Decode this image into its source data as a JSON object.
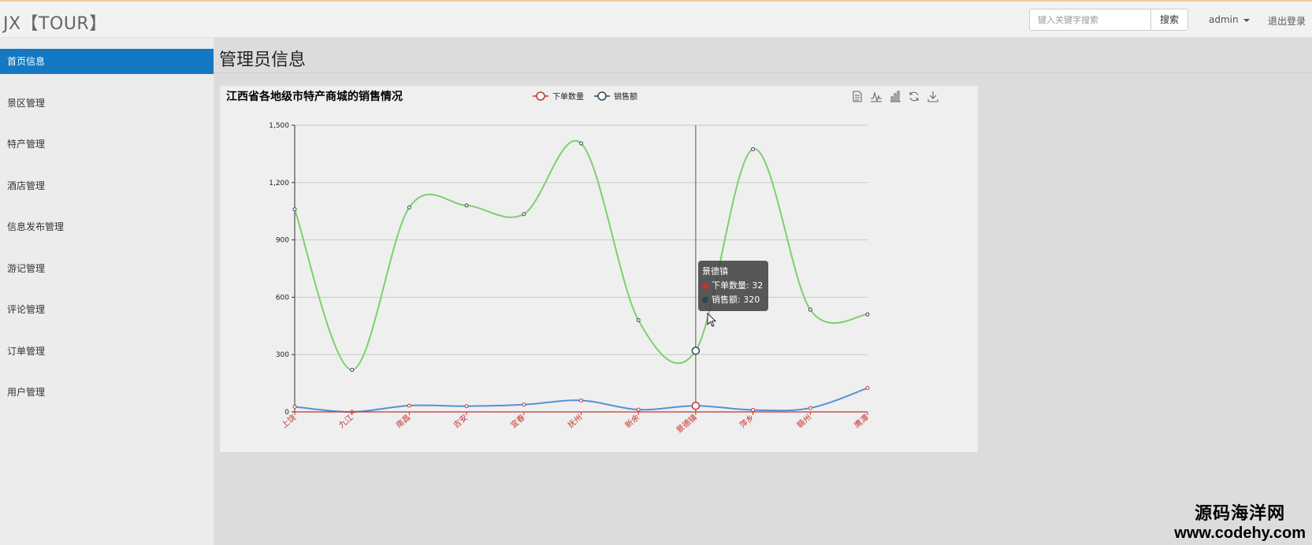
{
  "brand": "JX【TOUR】",
  "search": {
    "placeholder": "键入关键字搜索",
    "button_label": "搜索"
  },
  "user_menu": {
    "label": "admin"
  },
  "logout_label": "退出登录",
  "sidebar": {
    "items": [
      {
        "label": "首页信息",
        "active": true
      },
      {
        "label": "景区管理"
      },
      {
        "label": "特产管理"
      },
      {
        "label": "酒店管理"
      },
      {
        "label": "信息发布管理"
      },
      {
        "label": "游记管理"
      },
      {
        "label": "评论管理"
      },
      {
        "label": "订单管理"
      },
      {
        "label": "用户管理"
      }
    ]
  },
  "page_title": "管理员信息",
  "toolbox_icons": [
    "data-view-icon",
    "line-chart-icon",
    "bar-chart-icon",
    "refresh-icon",
    "download-icon"
  ],
  "tooltip": {
    "title": "景德镇",
    "rows": [
      {
        "name": "下单数量",
        "value": "32",
        "color": "#c23531"
      },
      {
        "name": "销售额",
        "value": "320",
        "color": "#2f4554"
      }
    ]
  },
  "watermark": {
    "cn": "源码海洋网",
    "url": "www.codehy.com"
  },
  "chart_data": {
    "type": "line",
    "title": "江西省各地级市特产商城的销售情况",
    "categories": [
      "上饶",
      "九江",
      "南昌",
      "吉安",
      "宜春",
      "抚州",
      "新余",
      "景德镇",
      "萍乡",
      "赣州",
      "鹰潭"
    ],
    "series": [
      {
        "name": "下单数量",
        "color": "#5b8ed6",
        "legend_color": "#c23531",
        "values": [
          27,
          0,
          33,
          30,
          38,
          60,
          12,
          32,
          10,
          20,
          125
        ]
      },
      {
        "name": "销售额",
        "color": "#7dcf6e",
        "legend_color": "#2f4554",
        "values": [
          1060,
          220,
          1070,
          1080,
          1035,
          1405,
          480,
          320,
          1375,
          535,
          510
        ]
      }
    ],
    "yticks": [
      "0",
      "300",
      "600",
      "900",
      "1,200",
      "1,500"
    ],
    "ylim": [
      0,
      1500
    ],
    "grid": true,
    "legend_position": "top-center",
    "highlight_index": 7,
    "axis_color": "#c23531"
  }
}
